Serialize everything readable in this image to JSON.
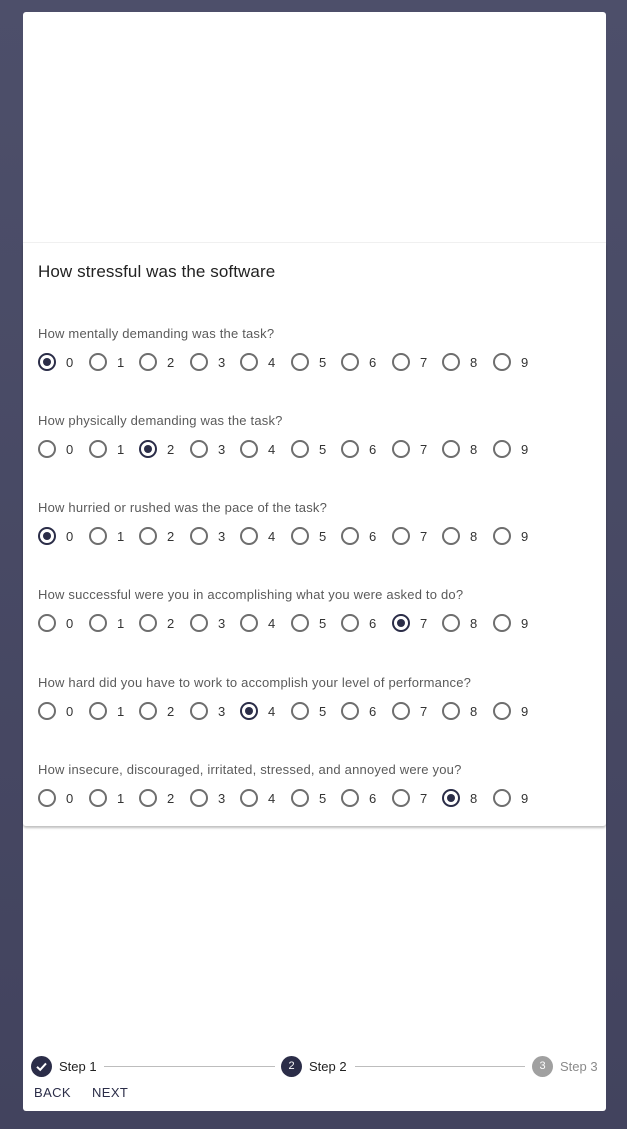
{
  "survey": {
    "title": "How stressful was the software",
    "options": [
      "0",
      "1",
      "2",
      "3",
      "4",
      "5",
      "6",
      "7",
      "8",
      "9"
    ],
    "questions": [
      {
        "label": "How mentally demanding was the task?",
        "selected": 0
      },
      {
        "label": "How physically demanding was the task?",
        "selected": 2
      },
      {
        "label": "How hurried or rushed was the pace of the task?",
        "selected": 0
      },
      {
        "label": "How successful were you in accomplishing what you were asked to do?",
        "selected": 7
      },
      {
        "label": "How hard did you have to work to accomplish your level of performance?",
        "selected": 4
      },
      {
        "label": "How insecure, discouraged, irritated, stressed, and annoyed were you?",
        "selected": 8
      }
    ]
  },
  "stepper": {
    "steps": [
      {
        "label": "Step 1",
        "marker": "check",
        "state": "completed"
      },
      {
        "label": "Step 2",
        "marker": "2",
        "state": "active"
      },
      {
        "label": "Step 3",
        "marker": "3",
        "state": "inactive"
      }
    ]
  },
  "nav": {
    "back_label": "BACK",
    "next_label": "NEXT"
  },
  "colors": {
    "accent": "#2b2d48",
    "background": "#4d4f6a",
    "inactive": "#a0a0a0"
  }
}
